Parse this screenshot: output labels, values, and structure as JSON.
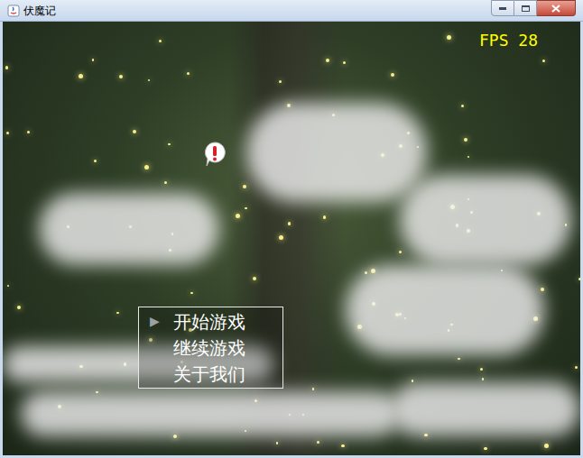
{
  "window": {
    "title": "伏魔记"
  },
  "hud": {
    "fps": "FPS 28"
  },
  "menu": {
    "cursor": "▶",
    "items": [
      {
        "label": "开始游戏",
        "selected": true
      },
      {
        "label": "继续游戏",
        "selected": false
      },
      {
        "label": "关于我们",
        "selected": false
      }
    ]
  }
}
